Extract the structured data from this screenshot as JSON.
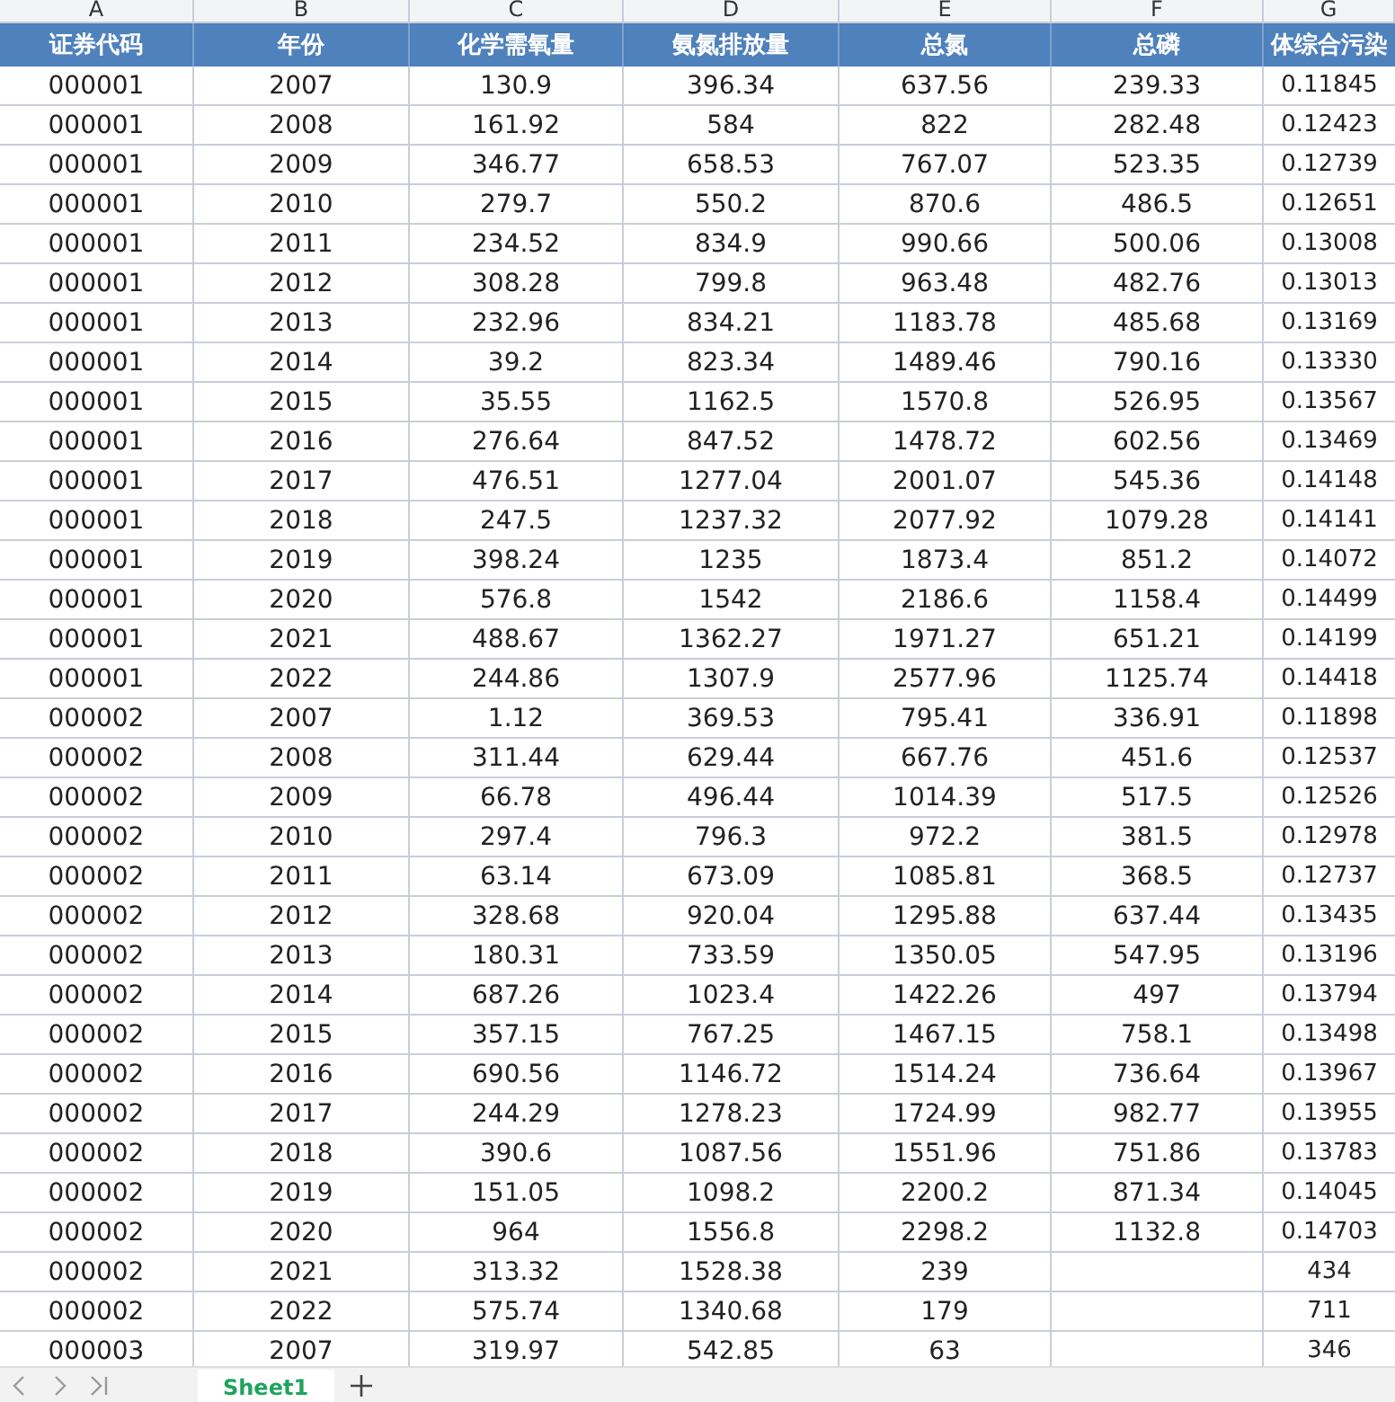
{
  "columns": [
    {
      "letter": "A",
      "heading": "证券代码"
    },
    {
      "letter": "B",
      "heading": "年份"
    },
    {
      "letter": "C",
      "heading": "化学需氧量"
    },
    {
      "letter": "D",
      "heading": "氨氮排放量"
    },
    {
      "letter": "E",
      "heading": "总氮"
    },
    {
      "letter": "F",
      "heading": "总磷"
    },
    {
      "letter": "G",
      "heading": "体综合污染"
    }
  ],
  "rows": [
    {
      "A": "000001",
      "B": "2007",
      "C": "130.9",
      "D": "396.34",
      "E": "637.56",
      "F": "239.33",
      "G": "0.11845"
    },
    {
      "A": "000001",
      "B": "2008",
      "C": "161.92",
      "D": "584",
      "E": "822",
      "F": "282.48",
      "G": "0.12423"
    },
    {
      "A": "000001",
      "B": "2009",
      "C": "346.77",
      "D": "658.53",
      "E": "767.07",
      "F": "523.35",
      "G": "0.12739"
    },
    {
      "A": "000001",
      "B": "2010",
      "C": "279.7",
      "D": "550.2",
      "E": "870.6",
      "F": "486.5",
      "G": "0.12651"
    },
    {
      "A": "000001",
      "B": "2011",
      "C": "234.52",
      "D": "834.9",
      "E": "990.66",
      "F": "500.06",
      "G": "0.13008"
    },
    {
      "A": "000001",
      "B": "2012",
      "C": "308.28",
      "D": "799.8",
      "E": "963.48",
      "F": "482.76",
      "G": "0.13013"
    },
    {
      "A": "000001",
      "B": "2013",
      "C": "232.96",
      "D": "834.21",
      "E": "1183.78",
      "F": "485.68",
      "G": "0.13169"
    },
    {
      "A": "000001",
      "B": "2014",
      "C": "39.2",
      "D": "823.34",
      "E": "1489.46",
      "F": "790.16",
      "G": "0.13330"
    },
    {
      "A": "000001",
      "B": "2015",
      "C": "35.55",
      "D": "1162.5",
      "E": "1570.8",
      "F": "526.95",
      "G": "0.13567"
    },
    {
      "A": "000001",
      "B": "2016",
      "C": "276.64",
      "D": "847.52",
      "E": "1478.72",
      "F": "602.56",
      "G": "0.13469"
    },
    {
      "A": "000001",
      "B": "2017",
      "C": "476.51",
      "D": "1277.04",
      "E": "2001.07",
      "F": "545.36",
      "G": "0.14148"
    },
    {
      "A": "000001",
      "B": "2018",
      "C": "247.5",
      "D": "1237.32",
      "E": "2077.92",
      "F": "1079.28",
      "G": "0.14141"
    },
    {
      "A": "000001",
      "B": "2019",
      "C": "398.24",
      "D": "1235",
      "E": "1873.4",
      "F": "851.2",
      "G": "0.14072"
    },
    {
      "A": "000001",
      "B": "2020",
      "C": "576.8",
      "D": "1542",
      "E": "2186.6",
      "F": "1158.4",
      "G": "0.14499"
    },
    {
      "A": "000001",
      "B": "2021",
      "C": "488.67",
      "D": "1362.27",
      "E": "1971.27",
      "F": "651.21",
      "G": "0.14199"
    },
    {
      "A": "000001",
      "B": "2022",
      "C": "244.86",
      "D": "1307.9",
      "E": "2577.96",
      "F": "1125.74",
      "G": "0.14418"
    },
    {
      "A": "000002",
      "B": "2007",
      "C": "1.12",
      "D": "369.53",
      "E": "795.41",
      "F": "336.91",
      "G": "0.11898"
    },
    {
      "A": "000002",
      "B": "2008",
      "C": "311.44",
      "D": "629.44",
      "E": "667.76",
      "F": "451.6",
      "G": "0.12537"
    },
    {
      "A": "000002",
      "B": "2009",
      "C": "66.78",
      "D": "496.44",
      "E": "1014.39",
      "F": "517.5",
      "G": "0.12526"
    },
    {
      "A": "000002",
      "B": "2010",
      "C": "297.4",
      "D": "796.3",
      "E": "972.2",
      "F": "381.5",
      "G": "0.12978"
    },
    {
      "A": "000002",
      "B": "2011",
      "C": "63.14",
      "D": "673.09",
      "E": "1085.81",
      "F": "368.5",
      "G": "0.12737"
    },
    {
      "A": "000002",
      "B": "2012",
      "C": "328.68",
      "D": "920.04",
      "E": "1295.88",
      "F": "637.44",
      "G": "0.13435"
    },
    {
      "A": "000002",
      "B": "2013",
      "C": "180.31",
      "D": "733.59",
      "E": "1350.05",
      "F": "547.95",
      "G": "0.13196"
    },
    {
      "A": "000002",
      "B": "2014",
      "C": "687.26",
      "D": "1023.4",
      "E": "1422.26",
      "F": "497",
      "G": "0.13794"
    },
    {
      "A": "000002",
      "B": "2015",
      "C": "357.15",
      "D": "767.25",
      "E": "1467.15",
      "F": "758.1",
      "G": "0.13498"
    },
    {
      "A": "000002",
      "B": "2016",
      "C": "690.56",
      "D": "1146.72",
      "E": "1514.24",
      "F": "736.64",
      "G": "0.13967"
    },
    {
      "A": "000002",
      "B": "2017",
      "C": "244.29",
      "D": "1278.23",
      "E": "1724.99",
      "F": "982.77",
      "G": "0.13955"
    },
    {
      "A": "000002",
      "B": "2018",
      "C": "390.6",
      "D": "1087.56",
      "E": "1551.96",
      "F": "751.86",
      "G": "0.13783"
    },
    {
      "A": "000002",
      "B": "2019",
      "C": "151.05",
      "D": "1098.2",
      "E": "2200.2",
      "F": "871.34",
      "G": "0.14045"
    },
    {
      "A": "000002",
      "B": "2020",
      "C": "964",
      "D": "1556.8",
      "E": "2298.2",
      "F": "1132.8",
      "G": "0.14703"
    },
    {
      "A": "000002",
      "B": "2021",
      "C": "313.32",
      "D": "1528.38",
      "E": "239",
      "G": "434"
    },
    {
      "A": "000002",
      "B": "2022",
      "C": "575.74",
      "D": "1340.68",
      "E": "179",
      "G": "711"
    },
    {
      "A": "000003",
      "B": "2007",
      "C": "319.97",
      "D": "542.85",
      "E": "63",
      "G": "346"
    }
  ],
  "sheet_tabs": [
    {
      "label": "Sheet1",
      "selected": true
    }
  ]
}
